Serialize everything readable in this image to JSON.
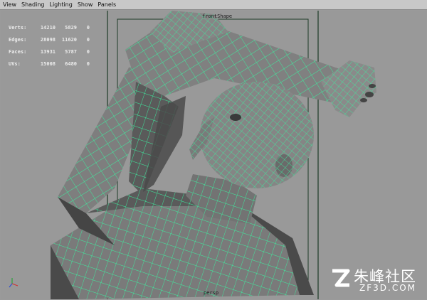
{
  "menu": {
    "items": [
      "View",
      "Shading",
      "Lighting",
      "Show",
      "Panels"
    ]
  },
  "stats": [
    {
      "label": "Verts:",
      "v1": "14210",
      "v2": "5829",
      "v3": "0"
    },
    {
      "label": "Edges:",
      "v1": "28098",
      "v2": "11620",
      "v3": "0"
    },
    {
      "label": "Faces:",
      "v1": "13931",
      "v2": "5787",
      "v3": "0"
    },
    {
      "label": "UVs:",
      "v1": "15008",
      "v2": "6480",
      "v3": "0"
    }
  ],
  "camera": {
    "top_label": "frontShape",
    "bottom_label": "persp"
  },
  "watermark": {
    "cn": "朱峰社区",
    "en": "ZF3D.COM"
  },
  "colors": {
    "wire": "#3cf0a0",
    "mesh_light": "#7d7d7d",
    "mesh_dark": "#444444",
    "frame": "#1d3a26",
    "background": "#999999"
  }
}
